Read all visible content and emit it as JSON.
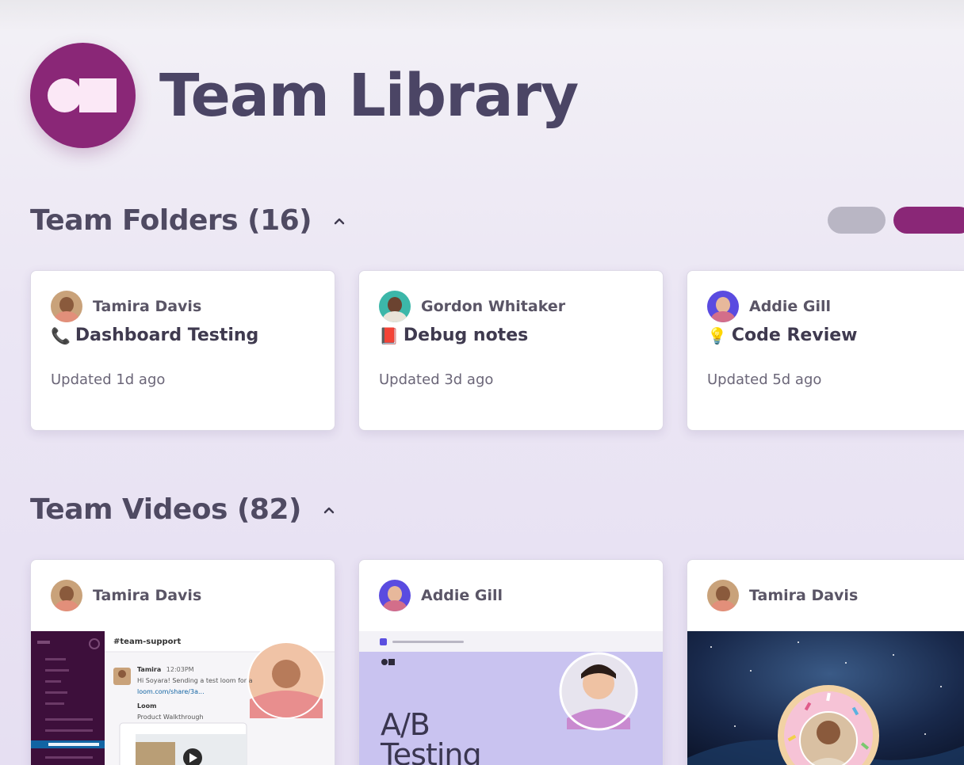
{
  "app": {
    "title": "Team Library"
  },
  "folders": {
    "heading": "Team Folders (16)",
    "collapse_icon": "chevron-up-icon",
    "items": [
      {
        "author": "Tamira Davis",
        "emoji": "📞",
        "title": "Dashboard Testing",
        "updated": "Updated 1d ago"
      },
      {
        "author": "Gordon Whitaker",
        "emoji": "📕",
        "title": "Debug notes",
        "updated": "Updated 3d ago"
      },
      {
        "author": "Addie Gill",
        "emoji": "💡",
        "title": "Code Review",
        "updated": "Updated 5d ago"
      }
    ]
  },
  "videos": {
    "heading": "Team Videos (82)",
    "collapse_icon": "chevron-up-icon",
    "items": [
      {
        "author": "Tamira Davis",
        "channel": "#team-support",
        "msg_author": "Tamira",
        "msg_time": "12:03PM",
        "msg_text": "Hi Soyara! Sending a test loom for a",
        "msg_link": "loom.com/share/3a...",
        "attach_title": "Loom",
        "attach_sub": "Product Walkthrough"
      },
      {
        "author": "Addie Gill",
        "slide_title_1": "A/B",
        "slide_title_2": "Testing"
      },
      {
        "author": "Tamira Davis"
      }
    ]
  },
  "colors": {
    "brand": "#8a2777",
    "title_text": "#4b4565",
    "pill_gray": "#b9b6c4"
  }
}
